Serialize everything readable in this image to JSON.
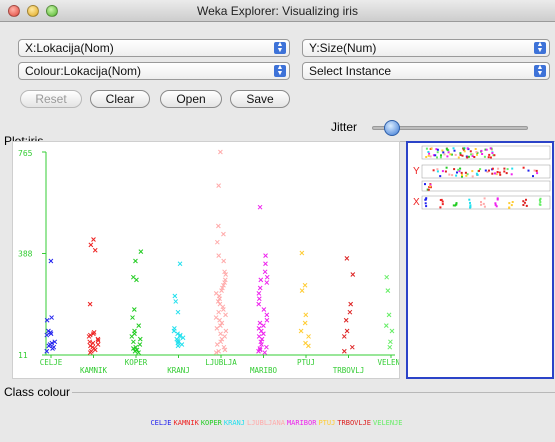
{
  "window": {
    "title": "Weka Explorer: Visualizing iris"
  },
  "controls": {
    "x_axis": "X:Lokacija(Nom)",
    "y_axis": "Y:Size(Num)",
    "colour": "Colour:Lokacija(Nom)",
    "select_instance": "Select Instance",
    "reset_label": "Reset",
    "clear_label": "Clear",
    "open_label": "Open",
    "save_label": "Save",
    "jitter_label": "Jitter",
    "jitter_value": 0.13
  },
  "plot": {
    "label": "Plot:iris"
  },
  "legend": {
    "label": "Class colour"
  },
  "panel": {
    "y_label": "Y",
    "x_label": "X"
  },
  "chart_data": {
    "type": "scatter",
    "ylim": [
      11,
      765
    ],
    "y_ticks": [
      "765",
      "388",
      "11"
    ],
    "categories": [
      "CELJE",
      "KAMNIK",
      "KOPER",
      "KRANJ",
      "LJUBLJA",
      "MARIBO",
      "PTUJ",
      "TRBOVLJ",
      "VELENJ"
    ],
    "legend_entries": [
      "CELJE",
      "KAMNIK",
      "KOPER",
      "KRANJ",
      "LJUBLJANA",
      "MARIBOR",
      "PTUJ",
      "TRBOVLJE",
      "VELENJE"
    ],
    "colors": [
      "#2222ee",
      "#ee2222",
      "#22cc22",
      "#22e0ee",
      "#ffaaaa",
      "#ee22ee",
      "#ffcc33",
      "#dd2222",
      "#66ee66"
    ],
    "series": [
      {
        "values": [
          360,
          150,
          140,
          100,
          95,
          90,
          85,
          60,
          55,
          50,
          45,
          40,
          35,
          25
        ]
      },
      {
        "values": [
          440,
          420,
          400,
          200,
          95,
          90,
          85,
          80,
          70,
          65,
          60,
          55,
          50,
          45,
          40,
          35,
          30,
          25,
          20
        ]
      },
      {
        "values": [
          395,
          360,
          300,
          290,
          180,
          150,
          120,
          100,
          90,
          80,
          70,
          60,
          50,
          40,
          35,
          30,
          25,
          20
        ]
      },
      {
        "values": [
          350,
          230,
          210,
          170,
          110,
          100,
          90,
          85,
          80,
          75,
          70,
          65,
          60,
          55,
          50,
          45
        ]
      },
      {
        "values": [
          765,
          640,
          490,
          460,
          430,
          380,
          360,
          320,
          310,
          290,
          280,
          270,
          260,
          250,
          240,
          230,
          220,
          210,
          200,
          190,
          180,
          170,
          160,
          150,
          140,
          130,
          120,
          110,
          100,
          90,
          80,
          70,
          60,
          50,
          40,
          30,
          25,
          20
        ]
      },
      {
        "values": [
          560,
          380,
          350,
          320,
          300,
          290,
          280,
          260,
          240,
          220,
          200,
          180,
          160,
          140,
          130,
          120,
          110,
          100,
          90,
          80,
          70,
          60,
          50,
          40,
          35,
          30,
          25,
          20
        ]
      },
      {
        "values": [
          390,
          270,
          250,
          160,
          130,
          100,
          80,
          55,
          45
        ]
      },
      {
        "values": [
          370,
          310,
          200,
          170,
          140,
          100,
          80,
          40,
          25
        ]
      },
      {
        "values": [
          300,
          250,
          160,
          120,
          100,
          60,
          40
        ]
      }
    ]
  }
}
